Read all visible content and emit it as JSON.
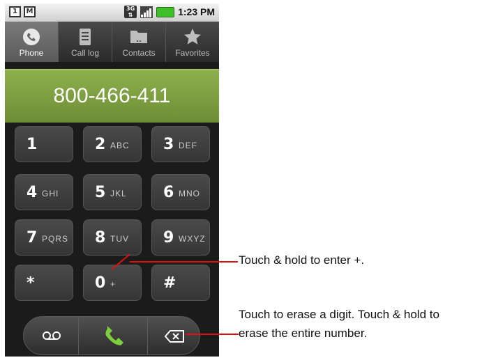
{
  "status_bar": {
    "sim_icon": "sim-card-icon",
    "mail_icon": "gmail-icon",
    "network_label": "3G",
    "time": "1:23 PM",
    "battery_color": "#3fbf2a"
  },
  "tabs": [
    {
      "label": "Phone",
      "icon": "phone-icon",
      "active": true
    },
    {
      "label": "Call log",
      "icon": "call-log-icon",
      "active": false
    },
    {
      "label": "Contacts",
      "icon": "contacts-icon",
      "active": false
    },
    {
      "label": "Favorites",
      "icon": "star-icon",
      "active": false
    }
  ],
  "display": {
    "number": "800-466-411",
    "color": "#7a9c40"
  },
  "keypad": {
    "keys": [
      {
        "digit": "1",
        "letters": ""
      },
      {
        "digit": "2",
        "letters": "ABC"
      },
      {
        "digit": "3",
        "letters": "DEF"
      },
      {
        "digit": "4",
        "letters": "GHI"
      },
      {
        "digit": "5",
        "letters": "JKL"
      },
      {
        "digit": "6",
        "letters": "MNO"
      },
      {
        "digit": "7",
        "letters": "PQRS"
      },
      {
        "digit": "8",
        "letters": "TUV"
      },
      {
        "digit": "9",
        "letters": "WXYZ"
      },
      {
        "digit": "*",
        "letters": ""
      },
      {
        "digit": "0",
        "letters": "+"
      },
      {
        "digit": "#",
        "letters": ""
      }
    ]
  },
  "bottom_bar": {
    "voicemail_icon": "voicemail-icon",
    "dial_icon": "dial-phone-icon",
    "dial_color": "#7cd13a",
    "delete_icon": "backspace-icon"
  },
  "callouts": {
    "plus": "Touch & hold to enter +.",
    "erase_line1": "Touch to erase a digit. Touch & hold to",
    "erase_line2": "erase the entire number.",
    "line_color": "#e01010"
  }
}
